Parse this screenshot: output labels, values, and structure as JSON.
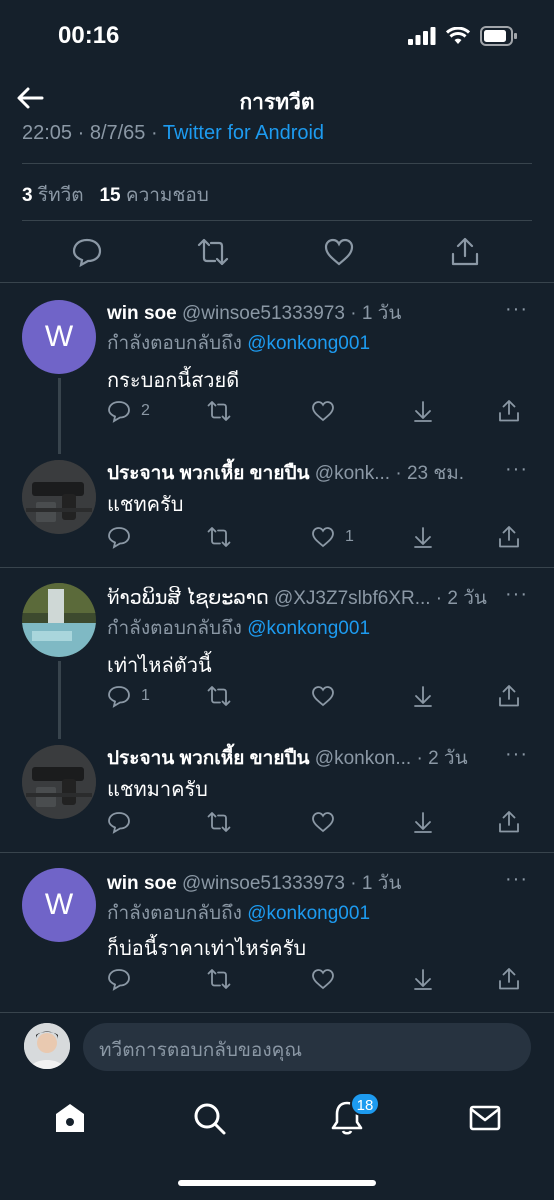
{
  "status_bar": {
    "time": "00:16"
  },
  "header": {
    "title": "การทวีต"
  },
  "detail": {
    "meta_time": "22:05 · 8/7/65 ·",
    "meta_source": "Twitter for Android",
    "retweet_count": "3",
    "retweet_label": "รีทวีต",
    "like_count": "15",
    "like_label": "ความชอบ"
  },
  "replies": [
    {
      "avatar_letter": "W",
      "name": "win soe",
      "handle_time": "@winsoe51333973 · 1 วัน",
      "reply_prefix": "กำลังตอบกลับถึง",
      "reply_mention": "@konkong001",
      "text": "กระบอกนี้สวยดี",
      "reply_count": "2",
      "like_count": ""
    },
    {
      "name": "ประจาน พวกเหี้ย ขายปืน",
      "handle_time": "@konk... · 23 ชม.",
      "text": "แชทครับ",
      "reply_count": "",
      "like_count": "1"
    },
    {
      "name": "ท້າວພິນສີ ໄຊຍະລາດ",
      "handle_time": "@XJ3Z7slbf6XR... · 2 วัน",
      "reply_prefix": "กำลังตอบกลับถึง",
      "reply_mention": "@konkong001",
      "text": "เท่าไหล่ตัวนี้",
      "reply_count": "1",
      "like_count": ""
    },
    {
      "name": "ประจาน พวกเหี้ย ขายปืน",
      "handle_time": "@konkon... · 2 วัน",
      "text": "แชทมาครับ",
      "reply_count": "",
      "like_count": ""
    },
    {
      "avatar_letter": "W",
      "name": "win soe",
      "handle_time": "@winsoe51333973 · 1 วัน",
      "reply_prefix": "กำลังตอบกลับถึง",
      "reply_mention": "@konkong001",
      "text": "ก็บ่อนี้ราคาเท่าไหร่ครับ",
      "reply_count": "",
      "like_count": ""
    }
  ],
  "compose": {
    "placeholder": "ทวีตการตอบกลับของคุณ"
  },
  "tabbar": {
    "notifications_badge": "18"
  },
  "more_label": "···",
  "colors": {
    "background": "#15202b",
    "accent": "#1d9bf0",
    "muted": "#8b98a5",
    "divider": "#38444d",
    "avatar_w": "#7064c8"
  }
}
